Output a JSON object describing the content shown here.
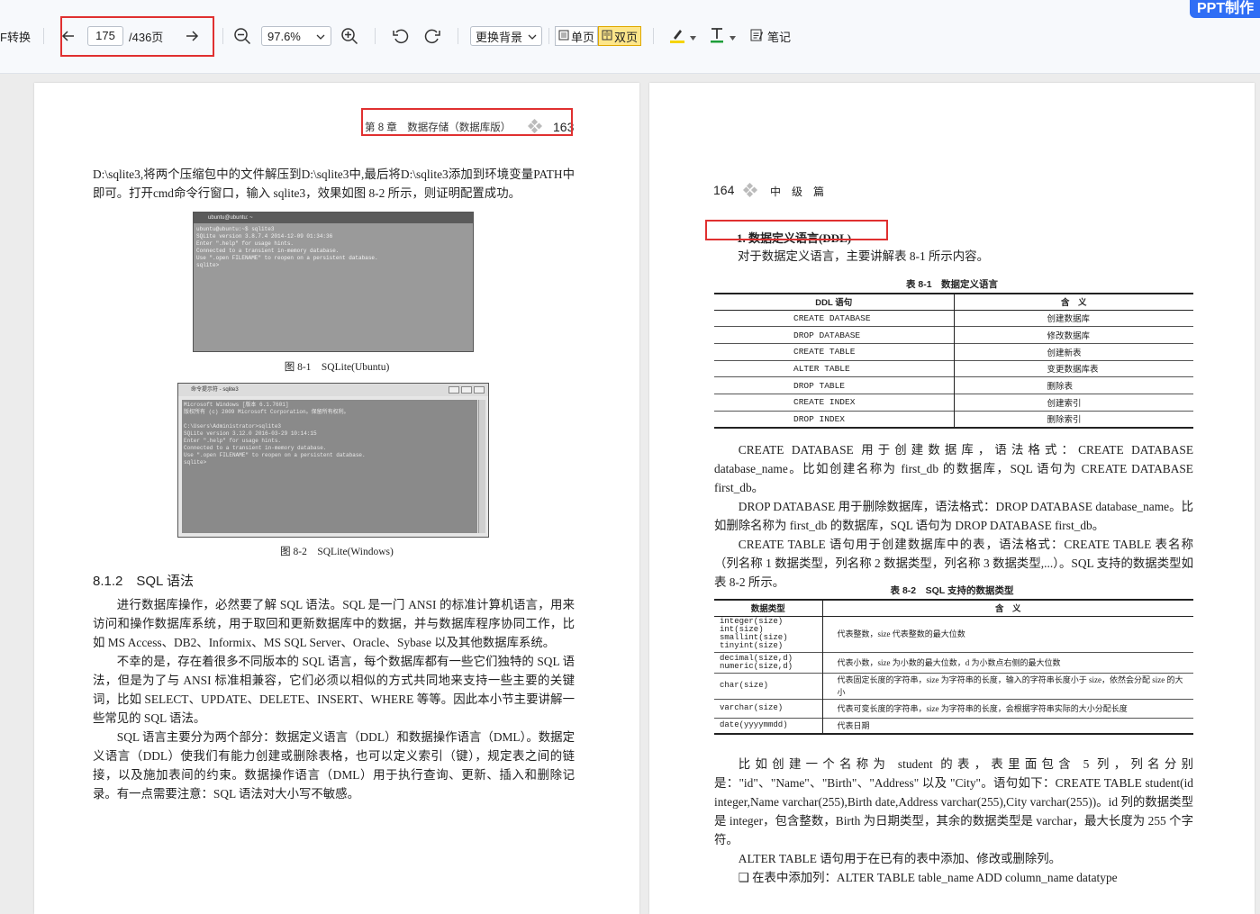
{
  "toolbar": {
    "pdf_convert": "F转换",
    "current_page": "175",
    "total_pages": "/436页",
    "zoom": "97.6%",
    "background": "更换背景",
    "single_page": "单页",
    "double_page": "双页",
    "notes": "笔记",
    "ppt_badge": "PPT制作",
    "colors": {
      "highlight": "#f5d400",
      "text_color": "#1e9e3a",
      "accent": "#2f6ef5",
      "annotation_box": "#e03030"
    }
  },
  "left_page": {
    "header_chapter": "第 8 章　数据存储（数据库版）",
    "header_page": "163",
    "intro": "D:\\sqlite3,将两个压缩包中的文件解压到D:\\sqlite3中,最后将D:\\sqlite3添加到环境变量PATH中即可。打开cmd命令行窗口，输入 sqlite3，效果如图 8-2 所示，则证明配置成功。",
    "fig1": {
      "title": "ubuntu@ubuntu: ~",
      "lines": "ubuntu@ubuntu:~$ sqlite3\nSQLite version 3.8.7.4 2014-12-09 01:34:36\nEnter \".help\" for usage hints.\nConnected to a transient in-memory database.\nUse \".open FILENAME\" to reopen on a persistent database.\nsqlite>",
      "caption": "图 8-1　SQLite(Ubuntu)"
    },
    "fig2": {
      "title": "命令提示符 - sqlite3",
      "lines": "Microsoft Windows [版本 6.1.7601]\n版权所有 (c) 2009 Microsoft Corporation。保留所有权利。\n\nC:\\Users\\Administrator>sqlite3\nSQLite version 3.12.0 2016-03-29 10:14:15\nEnter \".help\" for usage hints.\nConnected to a transient in-memory database.\nUse \".open FILENAME\" to reopen on a persistent database.\nsqlite>",
      "caption": "图 8-2　SQLite(Windows)"
    },
    "section_title": "8.1.2　SQL 语法",
    "p1": "进行数据库操作，必然要了解 SQL 语法。SQL 是一门 ANSI 的标准计算机语言，用来访问和操作数据库系统，用于取回和更新数据库中的数据，并与数据库程序协同工作，比如 MS Access、DB2、Informix、MS SQL Server、Oracle、Sybase 以及其他数据库系统。",
    "p2": "不幸的是，存在着很多不同版本的 SQL 语言，每个数据库都有一些它们独特的 SQL 语法，但是为了与 ANSI 标准相兼容，它们必须以相似的方式共同地来支持一些主要的关键词，比如 SELECT、UPDATE、DELETE、INSERT、WHERE 等等。因此本小节主要讲解一些常见的 SQL 语法。",
    "p3": "SQL 语言主要分为两个部分：数据定义语言（DDL）和数据操作语言（DML）。数据定义语言（DDL）使我们有能力创建或删除表格，也可以定义索引（键），规定表之间的链接，以及施加表间的约束。数据操作语言（DML）用于执行查询、更新、插入和删除记录。有一点需要注意：SQL 语法对大小写不敏感。"
  },
  "right_page": {
    "header_page": "164",
    "header_label": "中　级　篇",
    "subsection": "1. 数据定义语言(DDL)",
    "intro": "对于数据定义语言，主要讲解表 8-1 所示内容。",
    "table1": {
      "title": "表 8-1　数据定义语言",
      "headers": [
        "DDL 语句",
        "含　义"
      ],
      "rows": [
        [
          "CREATE DATABASE",
          "创建数据库"
        ],
        [
          "DROP DATABASE",
          "修改数据库"
        ],
        [
          "CREATE TABLE",
          "创建新表"
        ],
        [
          "ALTER TABLE",
          "变更数据库表"
        ],
        [
          "DROP TABLE",
          "删除表"
        ],
        [
          "CREATE INDEX",
          "创建索引"
        ],
        [
          "DROP INDEX",
          "删除索引"
        ]
      ]
    },
    "p1": "CREATE DATABASE 用于创建数据库，语法格式：CREATE DATABASE database_name。比如创建名称为 first_db 的数据库，SQL 语句为 CREATE DATABASE first_db。",
    "p2": "DROP DATABASE 用于删除数据库，语法格式：DROP DATABASE database_name。比如删除名称为 first_db 的数据库，SQL 语句为 DROP DATABASE first_db。",
    "p3": "CREATE TABLE 语句用于创建数据库中的表，语法格式：CREATE TABLE 表名称（列名称 1 数据类型，列名称 2 数据类型，列名称 3 数据类型,...）。SQL 支持的数据类型如表 8-2 所示。",
    "table2": {
      "title": "表 8-2　SQL 支持的数据类型",
      "headers": [
        "数据类型",
        "含　义"
      ],
      "rows": [
        [
          "integer(size)\nint(size)\nsmallint(size)\ntinyint(size)",
          "代表整数，size 代表整数的最大位数"
        ],
        [
          "decimal(size,d)\nnumeric(size,d)",
          "代表小数，size 为小数的最大位数，d 为小数点右侧的最大位数"
        ],
        [
          "char(size)",
          "代表固定长度的字符串，size 为字符串的长度，输入的字符串长度小于 size，依然会分配 size 的大小"
        ],
        [
          "varchar(size)",
          "代表可变长度的字符串，size 为字符串的长度，会根据字符串实际的大小分配长度"
        ],
        [
          "date(yyyymmdd)",
          "代表日期"
        ]
      ]
    },
    "p4": "比如创建一个名称为 student 的表，表里面包含 5 列，列名分别是：\"id\"、\"Name\"、\"Birth\"、\"Address\" 以及 \"City\"。语句如下：CREATE TABLE student(id integer,Name varchar(255),Birth date,Address varchar(255),City varchar(255))。id 列的数据类型是 integer，包含整数，Birth 为日期类型，其余的数据类型是 varchar，最大长度为 255 个字符。",
    "p5": "ALTER TABLE 语句用于在已有的表中添加、修改或删除列。",
    "bullet1": "在表中添加列：ALTER TABLE table_name ADD column_name datatype"
  }
}
